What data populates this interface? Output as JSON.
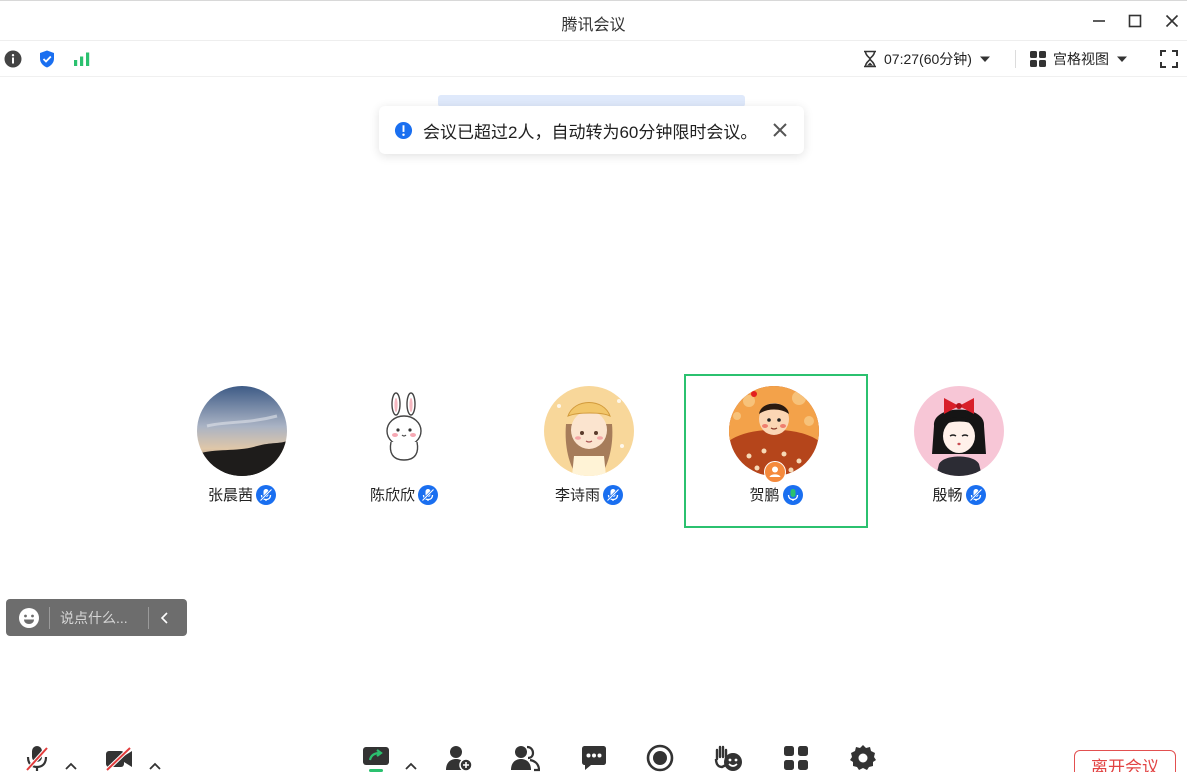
{
  "window": {
    "title": "腾讯会议"
  },
  "infobar": {
    "timer": "07:27(60分钟)",
    "view_label": "宫格视图"
  },
  "toast": {
    "message": "会议已超过2人，自动转为60分钟限时会议。"
  },
  "participants": [
    {
      "name": "张晨茜",
      "mic": "muted",
      "active": false
    },
    {
      "name": "陈欣欣",
      "mic": "muted",
      "active": false
    },
    {
      "name": "李诗雨",
      "mic": "muted",
      "active": false
    },
    {
      "name": "贺鹏",
      "mic": "on",
      "active": true,
      "host": true
    },
    {
      "name": "殷畅",
      "mic": "muted",
      "active": false
    }
  ],
  "chat": {
    "placeholder": "说点什么..."
  },
  "toolbar": {
    "leave_label": "离开会议"
  },
  "colors": {
    "accent": "#1a6ff0",
    "active_border": "#2bc16f",
    "signal": "#2bc16f",
    "leave": "#e24343",
    "chat_bg": "#6d6d6d"
  },
  "icons": {
    "mute": "microphone-muted-icon",
    "camera": "camera-off-icon",
    "share": "share-screen-icon",
    "invite": "invite-user-icon",
    "members": "members-icon",
    "chat": "chat-icon",
    "record": "record-icon",
    "hand": "raise-hand-icon",
    "apps": "apps-icon",
    "settings": "settings-icon"
  }
}
